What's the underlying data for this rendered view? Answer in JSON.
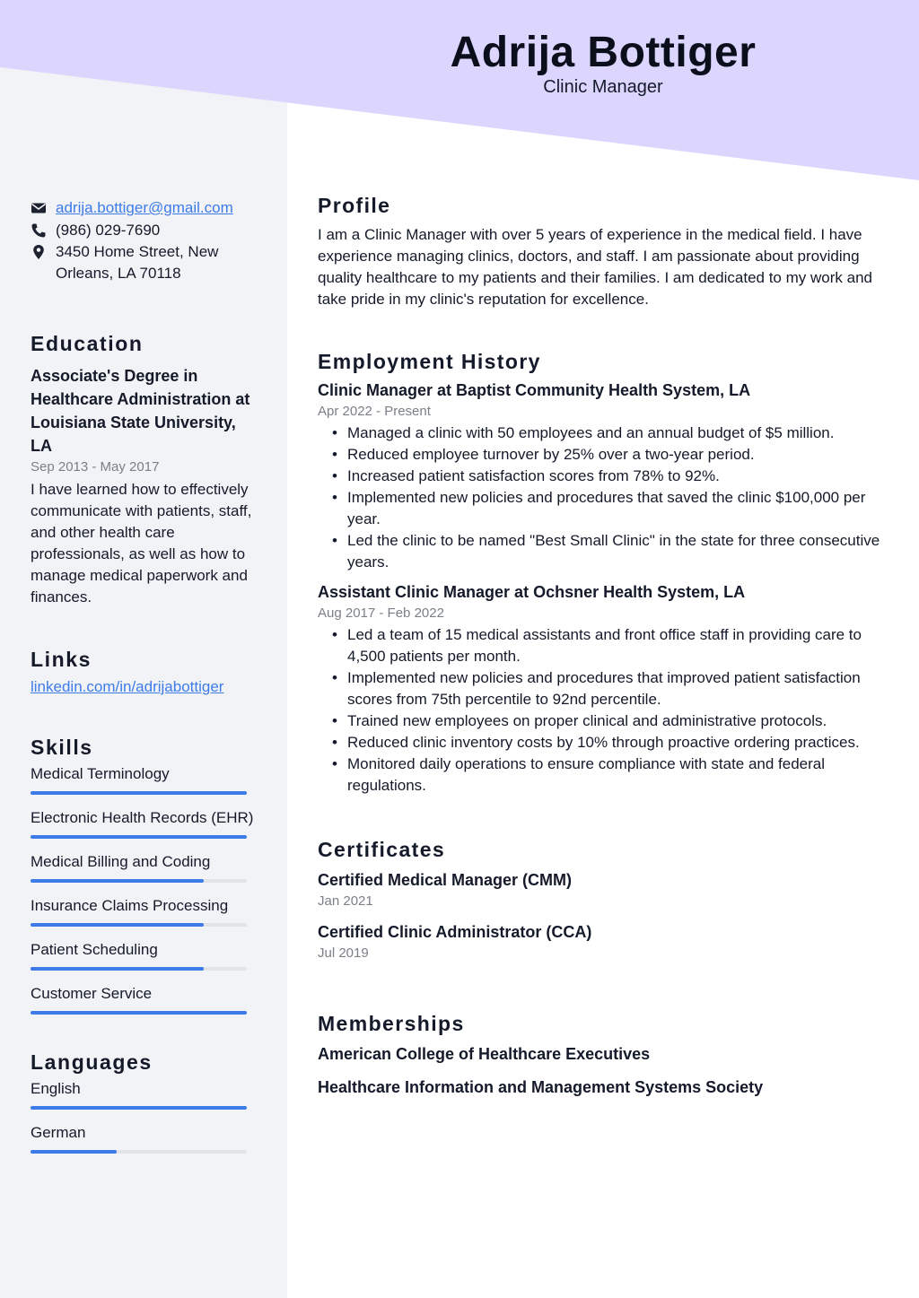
{
  "colors": {
    "header_band": "#dcd6fe",
    "sidebar_bg": "#f2f3f6",
    "accent": "#3d7be8",
    "bar_track": "#e3e4e8",
    "text": "#141a2a",
    "muted": "#7b7f88"
  },
  "header": {
    "name": "Adrija Bottiger",
    "role": "Clinic Manager"
  },
  "contact": {
    "email": "adrija.bottiger@gmail.com",
    "phone": "(986) 029-7690",
    "address": "3450 Home Street, New Orleans, LA 70118",
    "icons": [
      "envelope-icon",
      "phone-icon",
      "map-pin-icon"
    ]
  },
  "education": {
    "heading": "Education",
    "title": "Associate's Degree in Healthcare Administration at Louisiana State University, LA",
    "dates": "Sep 2013 - May 2017",
    "description": "I have learned how to effectively communicate with patients, staff, and other health care professionals, as well as how to manage medical paperwork and finances."
  },
  "links": {
    "heading": "Links",
    "items": [
      {
        "label": "linkedin.com/in/adrijabottiger"
      }
    ]
  },
  "skills": {
    "heading": "Skills",
    "items": [
      {
        "name": "Medical Terminology",
        "level": 1.0
      },
      {
        "name": "Electronic Health Records (EHR)",
        "level": 1.0
      },
      {
        "name": "Medical Billing and Coding",
        "level": 0.8
      },
      {
        "name": "Insurance Claims Processing",
        "level": 0.8
      },
      {
        "name": "Patient Scheduling",
        "level": 0.8
      },
      {
        "name": "Customer Service",
        "level": 1.0
      }
    ]
  },
  "languages": {
    "heading": "Languages",
    "items": [
      {
        "name": "English",
        "level": 1.0
      },
      {
        "name": "German",
        "level": 0.4
      }
    ]
  },
  "profile": {
    "heading": "Profile",
    "text": "I am a Clinic Manager with over 5 years of experience in the medical field. I have experience managing clinics, doctors, and staff. I am passionate about providing quality healthcare to my patients and their families. I am dedicated to my work and take pride in my clinic's reputation for excellence."
  },
  "employment": {
    "heading": "Employment History",
    "jobs": [
      {
        "title": "Clinic Manager at Baptist Community Health System, LA",
        "dates": "Apr 2022 - Present",
        "bullets": [
          "Managed a clinic with 50 employees and an annual budget of $5 million.",
          "Reduced employee turnover by 25% over a two-year period.",
          "Increased patient satisfaction scores from 78% to 92%.",
          "Implemented new policies and procedures that saved the clinic $100,000 per year.",
          "Led the clinic to be named \"Best Small Clinic\" in the state for three consecutive years."
        ]
      },
      {
        "title": "Assistant Clinic Manager at Ochsner Health System, LA",
        "dates": "Aug 2017 - Feb 2022",
        "bullets": [
          "Led a team of 15 medical assistants and front office staff in providing care to 4,500 patients per month.",
          "Implemented new policies and procedures that improved patient satisfaction scores from 75th percentile to 92nd percentile.",
          "Trained new employees on proper clinical and administrative protocols.",
          "Reduced clinic inventory costs by 10% through proactive ordering practices.",
          "Monitored daily operations to ensure compliance with state and federal regulations."
        ]
      }
    ]
  },
  "certificates": {
    "heading": "Certificates",
    "items": [
      {
        "title": "Certified Medical Manager (CMM)",
        "date": "Jan 2021"
      },
      {
        "title": "Certified Clinic Administrator (CCA)",
        "date": "Jul 2019"
      }
    ]
  },
  "memberships": {
    "heading": "Memberships",
    "items": [
      "American College of Healthcare Executives",
      "Healthcare Information and Management Systems Society"
    ]
  }
}
